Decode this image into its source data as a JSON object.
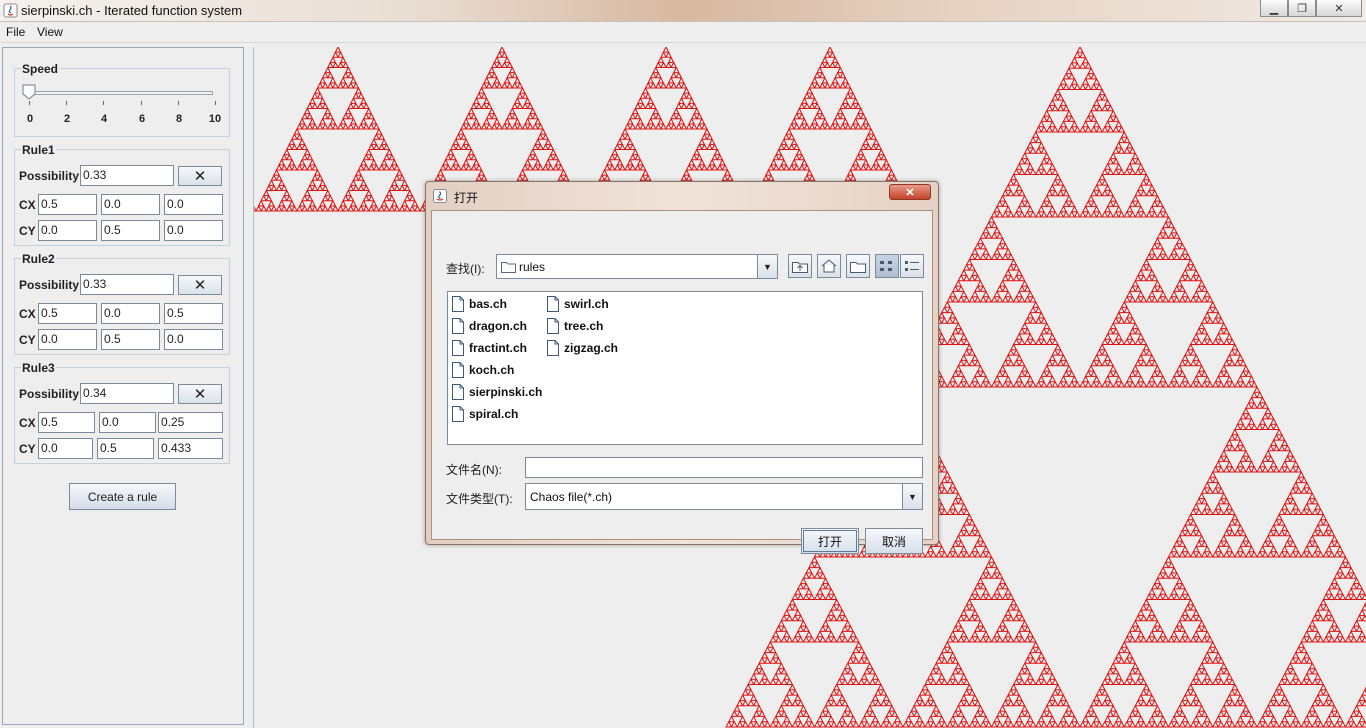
{
  "window": {
    "title": "sierpinski.ch - Iterated function system",
    "buttons": {
      "minimize": "▁",
      "maximize": "❐",
      "close": "✕"
    }
  },
  "menubar": {
    "items": [
      {
        "label": "File"
      },
      {
        "label": "View"
      }
    ]
  },
  "speed": {
    "title": "Speed",
    "value": 0,
    "min": 0,
    "max": 10,
    "ticks": [
      "0",
      "2",
      "4",
      "6",
      "8",
      "10"
    ]
  },
  "rules": [
    {
      "title": "Rule1",
      "possibility_label": "Possibility",
      "possibility": "0.33",
      "cx_label": "CX",
      "cx": [
        "0.5",
        "0.0",
        "0.0"
      ],
      "cy_label": "CY",
      "cy": [
        "0.0",
        "0.5",
        "0.0"
      ]
    },
    {
      "title": "Rule2",
      "possibility_label": "Possibility",
      "possibility": "0.33",
      "cx_label": "CX",
      "cx": [
        "0.5",
        "0.0",
        "0.5"
      ],
      "cy_label": "CY",
      "cy": [
        "0.0",
        "0.5",
        "0.0"
      ]
    },
    {
      "title": "Rule3",
      "possibility_label": "Possibility",
      "possibility": "0.34",
      "cx_label": "CX",
      "cx": [
        "0.5",
        "0.0",
        "0.25"
      ],
      "cy_label": "CY",
      "cy": [
        "0.0",
        "0.5",
        "0.433"
      ]
    }
  ],
  "delete_glyph": "✕",
  "create_rule_label": "Create a rule",
  "fractal": {
    "color": "#dd1111",
    "depth": 7
  },
  "dialog": {
    "title": "打开",
    "look_in_label": "查找(I):",
    "look_in_value": "rules",
    "files": [
      "bas.ch",
      "dragon.ch",
      "fractint.ch",
      "koch.ch",
      "sierpinski.ch",
      "spiral.ch",
      "swirl.ch",
      "tree.ch",
      "zigzag.ch"
    ],
    "filename_label": "文件名(N):",
    "filename_value": "",
    "filetype_label": "文件类型(T):",
    "filetype_value": "Chaos file(*.ch)",
    "open_label": "打开",
    "cancel_label": "取消"
  }
}
